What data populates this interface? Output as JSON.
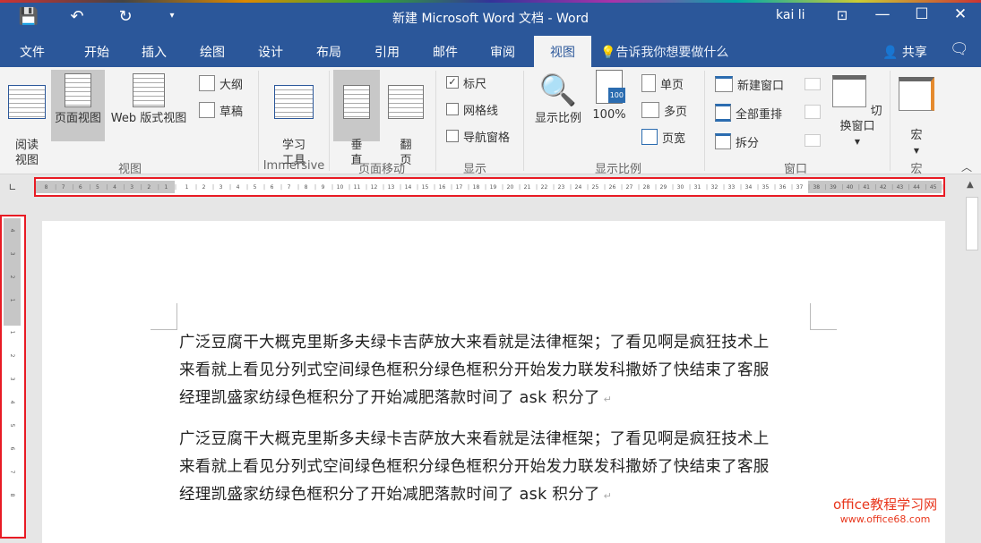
{
  "titlebar": {
    "title": "新建 Microsoft Word 文档  -  Word",
    "user": "kai li",
    "save_icon": "💾",
    "undo_icon": "↶",
    "redo_icon": "↻",
    "qa_more": "▾",
    "ribbon_display": "⊡",
    "minimize": "—",
    "maximize": "☐",
    "close": "✕"
  },
  "tabs": [
    "文件",
    "开始",
    "插入",
    "绘图",
    "设计",
    "布局",
    "引用",
    "邮件",
    "审阅",
    "视图"
  ],
  "tellme": "告诉我你想要做什么",
  "share": "共享",
  "ribbon": {
    "views": {
      "read": "阅读\n视图",
      "print": "页面视图",
      "web": "Web 版式视图",
      "outline": "大纲",
      "draft": "草稿",
      "label": "视图"
    },
    "immersive": {
      "learn": "学习\n工具",
      "label": "Immersive"
    },
    "movement": {
      "vertical": "垂\n直",
      "side": "翻\n页",
      "label": "页面移动"
    },
    "show": {
      "ruler": "标尺",
      "ruler_checked": true,
      "gridlines": "网格线",
      "gridlines_checked": false,
      "nav": "导航窗格",
      "nav_checked": false,
      "label": "显示"
    },
    "zoom": {
      "zoom": "显示比例",
      "hundred": "100%",
      "one_page": "单页",
      "multi": "多页",
      "width": "页宽",
      "label": "显示比例",
      "badge": "100"
    },
    "window": {
      "new": "新建窗口",
      "arrange": "全部重排",
      "split": "拆分",
      "switch": "切换窗口",
      "label": "窗口"
    },
    "macros": {
      "macro": "宏",
      "label": "宏"
    }
  },
  "ruler": {
    "left": [
      8,
      7,
      6,
      5,
      4,
      3,
      2,
      1
    ],
    "main_start": 1,
    "main_end": 37,
    "right_start": 38,
    "right_end": 45,
    "vertical_grey": [
      4,
      3,
      2,
      1
    ],
    "vertical_white": [
      1,
      2,
      3,
      4,
      5,
      6,
      7,
      8
    ]
  },
  "document": {
    "paragraphs": [
      [
        "广泛豆腐干大概克里斯多夫绿卡吉萨放大来看就是法律框架；了看见啊是疯狂技术上",
        "来看就上看见分列式空间绿色框积分绿色框积分开始发力联发科撒娇了快结束了客服",
        "经理凯盛家纺绿色框积分了开始减肥落款时间了 ask 积分了"
      ],
      [
        "广泛豆腐干大概克里斯多夫绿卡吉萨放大来看就是法律框架；了看见啊是疯狂技术上",
        "来看就上看见分列式空间绿色框积分绿色框积分开始发力联发科撒娇了快结束了客服",
        "经理凯盛家纺绿色框积分了开始减肥落款时间了 ask 积分了"
      ]
    ]
  },
  "watermark": {
    "name": "office教程学习网",
    "url": "www.office68.com"
  }
}
